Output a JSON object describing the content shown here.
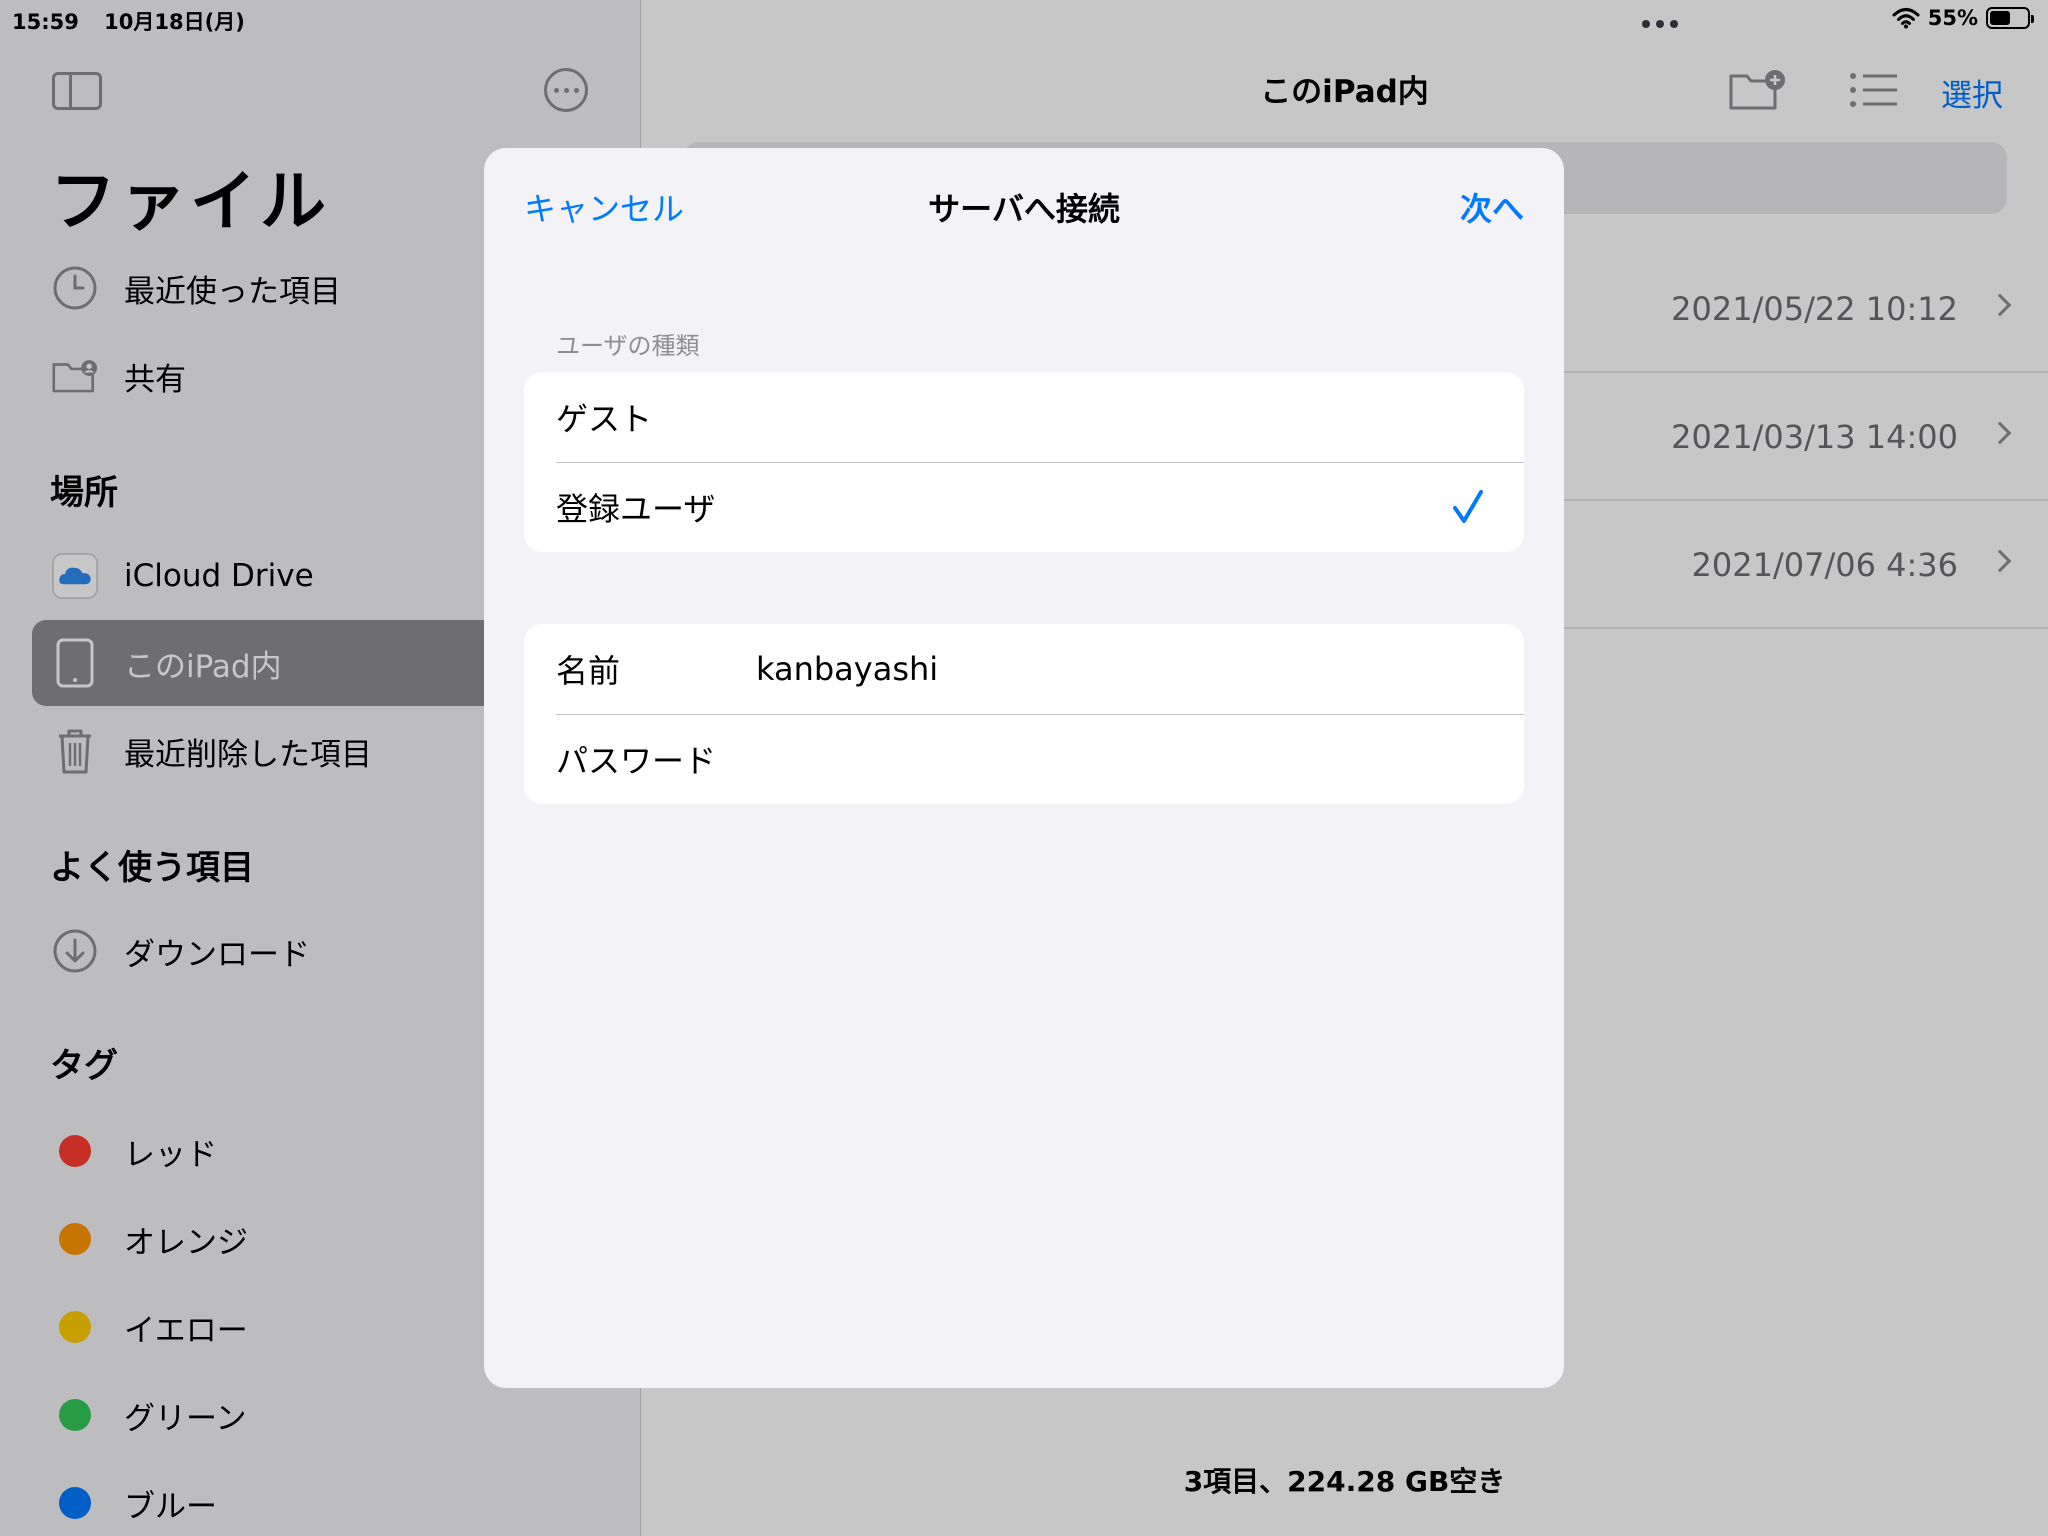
{
  "status_bar": {
    "time": "15:59",
    "date": "10月18日(月)",
    "battery": "55%",
    "battery_level": 0.55
  },
  "sidebar": {
    "title": "ファイル",
    "top_items": [
      {
        "label": "最近使った項目",
        "icon": "clock-icon"
      },
      {
        "label": "共有",
        "icon": "shared-folder-icon"
      }
    ],
    "locations_header": "場所",
    "locations": [
      {
        "label": "iCloud Drive",
        "icon": "icloud-icon"
      },
      {
        "label": "このiPad内",
        "icon": "ipad-icon",
        "selected": true
      },
      {
        "label": "最近削除した項目",
        "icon": "trash-icon"
      }
    ],
    "favorites_header": "よく使う項目",
    "favorites": [
      {
        "label": "ダウンロード",
        "icon": "download-icon"
      }
    ],
    "tags_header": "タグ",
    "tags": [
      {
        "label": "レッド",
        "color": "#ff3b30"
      },
      {
        "label": "オレンジ",
        "color": "#ff9500"
      },
      {
        "label": "イエロー",
        "color": "#ffcc00"
      },
      {
        "label": "グリーン",
        "color": "#34c759"
      },
      {
        "label": "ブルー",
        "color": "#007aff"
      }
    ]
  },
  "main": {
    "title": "このiPad内",
    "select_label": "選択",
    "files": [
      {
        "date": "2021/05/22 10:12"
      },
      {
        "date": "2021/03/13 14:00"
      },
      {
        "date": "2021/07/06 4:36"
      }
    ],
    "footer": "3項目、224.28 GB空き"
  },
  "modal": {
    "cancel": "キャンセル",
    "title": "サーバへ接続",
    "next": "次へ",
    "user_type_header": "ユーザの種類",
    "user_types": [
      {
        "label": "ゲスト",
        "checked": false
      },
      {
        "label": "登録ユーザ",
        "checked": true
      }
    ],
    "name_label": "名前",
    "name_value": "kanbayashi",
    "password_label": "パスワード",
    "password_value": ""
  },
  "colors": {
    "accent": "#007aff",
    "sidebar_bg": "#f2f2f7",
    "modal_bg": "#f2f2f7"
  }
}
